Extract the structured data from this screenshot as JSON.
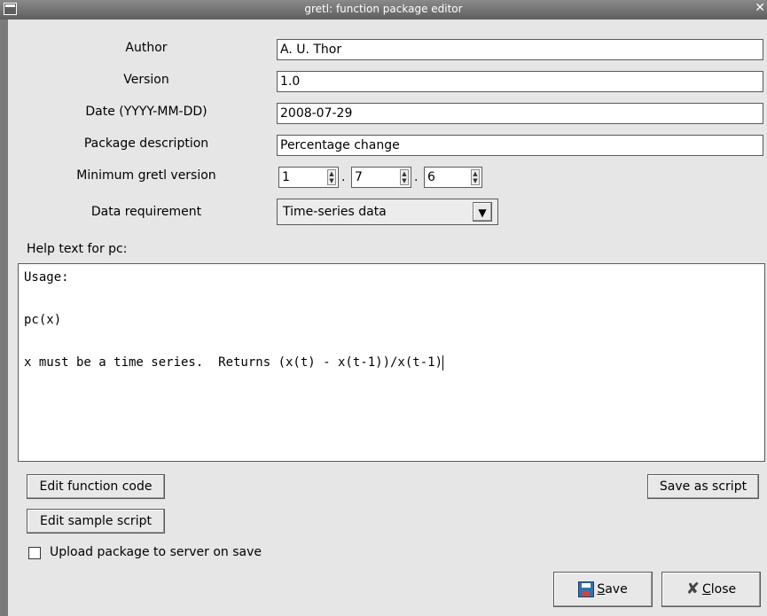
{
  "window": {
    "title": "gretl: function package editor"
  },
  "form": {
    "author_label": "Author",
    "author_value": "A. U. Thor",
    "version_label": "Version",
    "version_value": "1.0",
    "date_label": "Date (YYYY-MM-DD)",
    "date_value": "2008-07-29",
    "description_label": "Package description",
    "description_value": "Percentage change",
    "min_version_label": "Minimum gretl version",
    "min_version": {
      "major": "1",
      "minor": "7",
      "patch": "6",
      "separator": "."
    },
    "data_req_label": "Data requirement",
    "data_req_value": "Time-series data"
  },
  "help": {
    "label": "Help text for pc:",
    "lines": [
      "Usage:",
      "",
      "pc(x)",
      "",
      "x must be a time series.  Returns (x(t) - x(t-1))/x(t-1)"
    ]
  },
  "buttons": {
    "edit_function_code": "Edit function code",
    "save_as_script": "Save as script",
    "edit_sample_script": "Edit sample script",
    "save_mnemonic": "S",
    "save_rest": "ave",
    "close_mnemonic": "C",
    "close_rest": "lose"
  },
  "upload": {
    "label": "Upload package to server on save",
    "checked": false
  },
  "icons": {
    "window_menu": "window-menu-icon",
    "window_close": "window-close-icon",
    "save": "floppy-disk-icon",
    "close": "close-x-icon",
    "spin": "spin-arrows-icon",
    "dropdown": "dropdown-arrow-icon"
  }
}
